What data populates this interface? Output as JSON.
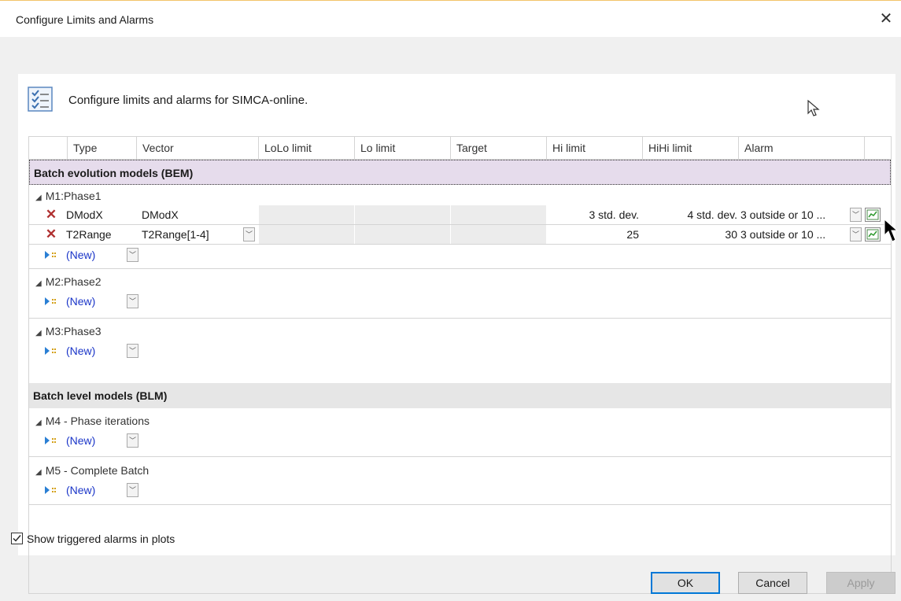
{
  "window": {
    "title": "Configure Limits and Alarms",
    "close_glyph": "✕"
  },
  "header": {
    "text": "Configure limits and alarms for SIMCA-online."
  },
  "columns": [
    "Type",
    "Vector",
    "LoLo limit",
    "Lo limit",
    "Target",
    "Hi limit",
    "HiHi limit",
    "Alarm"
  ],
  "sections": {
    "bem": {
      "label": "Batch evolution models (BEM)"
    },
    "blm": {
      "label": "Batch level models (BLM)"
    }
  },
  "groups": {
    "m1": {
      "label": "M1:Phase1"
    },
    "m2": {
      "label": "M2:Phase2"
    },
    "m3": {
      "label": "M3:Phase3"
    },
    "m4": {
      "label": "M4 - Phase iterations"
    },
    "m5": {
      "label": "M5 - Complete Batch"
    }
  },
  "rows": {
    "dmodx": {
      "type": "DModX",
      "vector": "DModX",
      "hi": "3 std. dev.",
      "hihi": "4 std. dev.",
      "alarm": "3 outside or 10 ..."
    },
    "t2range": {
      "type": "T2Range",
      "vector": "T2Range[1-4]",
      "hi": "25",
      "hihi": "30",
      "alarm": "3 outside or 10 ..."
    }
  },
  "new_label": "(New)",
  "footer": {
    "show_alarms_label": "Show triggered alarms in plots",
    "show_alarms_checked": true,
    "ok": "OK",
    "cancel": "Cancel",
    "apply": "Apply"
  },
  "colors": {
    "accent": "#0078d7",
    "bem_band": "#e6dcec",
    "delete_red": "#b03030",
    "new_link": "#1a35c8"
  }
}
